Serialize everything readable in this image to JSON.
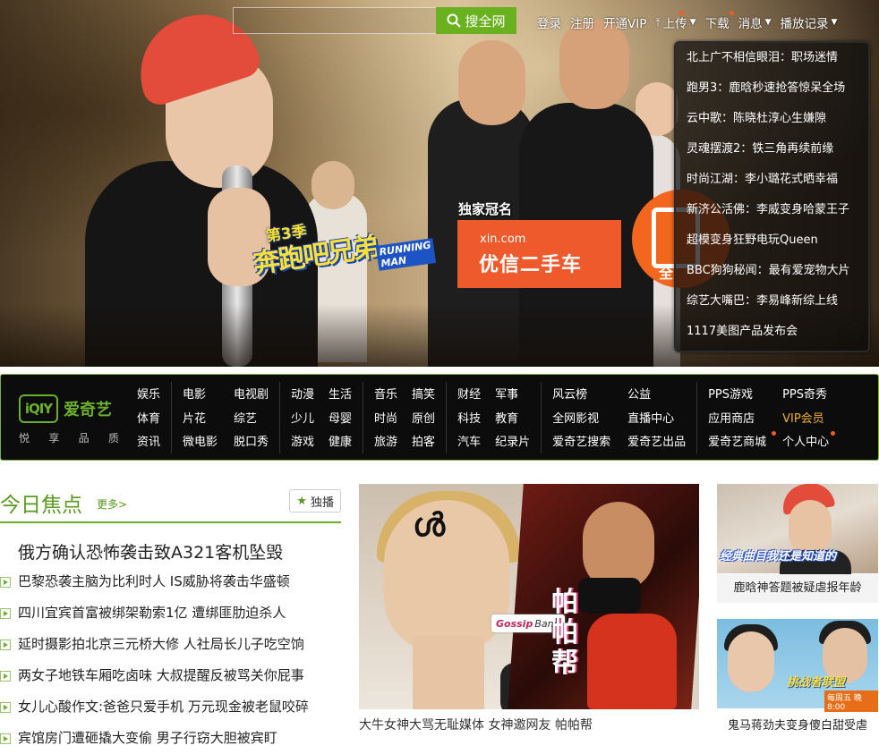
{
  "search": {
    "placeholder": "",
    "button_label": "搜全网"
  },
  "topnav": {
    "login": "登录",
    "register": "注册",
    "open_vip": "开通VIP",
    "upload": "上传",
    "download": "下载",
    "messages": "消息",
    "history": "播放记录"
  },
  "hero": {
    "show_logo": {
      "season": "第3季",
      "name": "奔跑吧兄弟",
      "en": "RUNNING MAN"
    },
    "sponsor_label": "独家冠名",
    "sponsor_domain": "xin.com",
    "sponsor_name": "优信二手车",
    "badge_text": "全"
  },
  "playlist": [
    "北上广不相信眼泪：职场迷情",
    "跑男3：鹿晗秒速抢答惊呆全场",
    "云中歌：陈晓杜淳心生嫌隙",
    "灵魂摆渡2：铁三角再续前缘",
    "时尚江湖：李小璐花式晒幸福",
    "新济公活佛：李威变身哈蒙王子",
    "超模变身狂野电玩Queen",
    "BBC狗狗秘闻：最有爱宠物大片",
    "综艺大嘴巴：李易峰新综上线",
    "1117美图产品发布会"
  ],
  "logo": {
    "mark": "iQIY",
    "name": "爱奇艺",
    "slogan": [
      "悦",
      "享",
      "品",
      "质"
    ]
  },
  "nav": {
    "c1": [
      "娱乐",
      "体育",
      "资讯"
    ],
    "c2a": [
      "电影",
      "片花",
      "微电影"
    ],
    "c2b": [
      "电视剧",
      "综艺",
      "脱口秀"
    ],
    "c3a": [
      "动漫",
      "少儿",
      "游戏"
    ],
    "c3b": [
      "生活",
      "母婴",
      "健康"
    ],
    "c4a": [
      "音乐",
      "时尚",
      "旅游"
    ],
    "c4b": [
      "搞笑",
      "原创",
      "拍客"
    ],
    "c5a": [
      "财经",
      "科技",
      "汽车"
    ],
    "c5b": [
      "军事",
      "教育",
      "纪录片"
    ],
    "c6a": [
      "风云榜",
      "全网影视",
      "爱奇艺搜索"
    ],
    "c6b": [
      "公益",
      "直播中心",
      "爱奇艺出品"
    ],
    "c7a": [
      "PPS游戏",
      "应用商店",
      "爱奇艺商城"
    ],
    "c7b": [
      "PPS奇秀",
      "VIP会员",
      "个人中心"
    ]
  },
  "focus": {
    "title": "今日焦点",
    "more": "更多>",
    "exclusive": "独播",
    "headline": "俄方确认恐怖袭击致A321客机坠毁",
    "items": [
      "巴黎恐袭主脑为比利时人 IS威胁将袭击华盛顿",
      "四川宜宾首富被绑架勒索1亿 遭绑匪肋迫杀人",
      "延时摄影拍北京三元桥大修 人社局长儿子吃空饷",
      "两女子地铁车厢吃卤味 大叔提醒反被骂关你屁事",
      "女儿心酸作文:爸爸只爱手机 万元现金被老鼠咬碎",
      "宾馆房门遭砸撬大变偷 男子行窃大胆被宾盯"
    ]
  },
  "gossip": {
    "tag_a": "Gossip",
    "tag_b": "Bang",
    "vertical": "帕帕帮",
    "caption": "大牛女神大骂无耻媒体 女神邀网友 帕帕帮"
  },
  "thumbs": [
    {
      "overlay": "经典曲目我还是知道的",
      "title": "鹿晗神答题被疑虐报年龄"
    },
    {
      "overlay": "挑战者联盟",
      "schedule": "每周五 晚8:00",
      "title": "鬼马蒋劲夫变身傻白甜受虐"
    }
  ],
  "colors": {
    "brand_green": "#6cb02a",
    "accent_orange": "#f35d1e",
    "vip_gold": "#f0b02a"
  }
}
